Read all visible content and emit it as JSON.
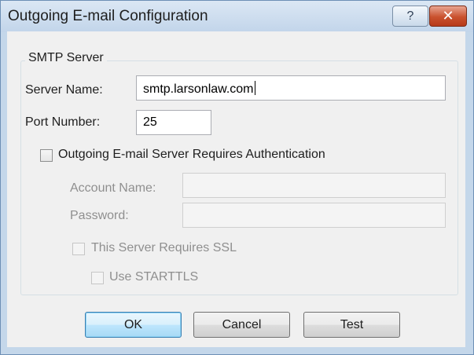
{
  "window": {
    "title": "Outgoing E-mail Configuration",
    "help_glyph": "?",
    "close_glyph": "✕"
  },
  "smtp": {
    "group_title": "SMTP Server",
    "server_name_label": "Server Name:",
    "server_name_value": "smtp.larsonlaw.com",
    "port_label": "Port Number:",
    "port_value": "25",
    "auth_label": "Outgoing E-mail Server Requires Authentication",
    "auth_checked": false,
    "account_name_label": "Account Name:",
    "account_name_value": "",
    "password_label": "Password:",
    "password_value": "",
    "ssl_label": "This Server Requires SSL",
    "starttls_label": "Use STARTTLS"
  },
  "buttons": {
    "ok": "OK",
    "cancel": "Cancel",
    "test": "Test"
  },
  "colors": {
    "accent_default_button": "#3c7fb1",
    "close_button": "#c9512e",
    "titlebar": "#c2d5ea"
  }
}
